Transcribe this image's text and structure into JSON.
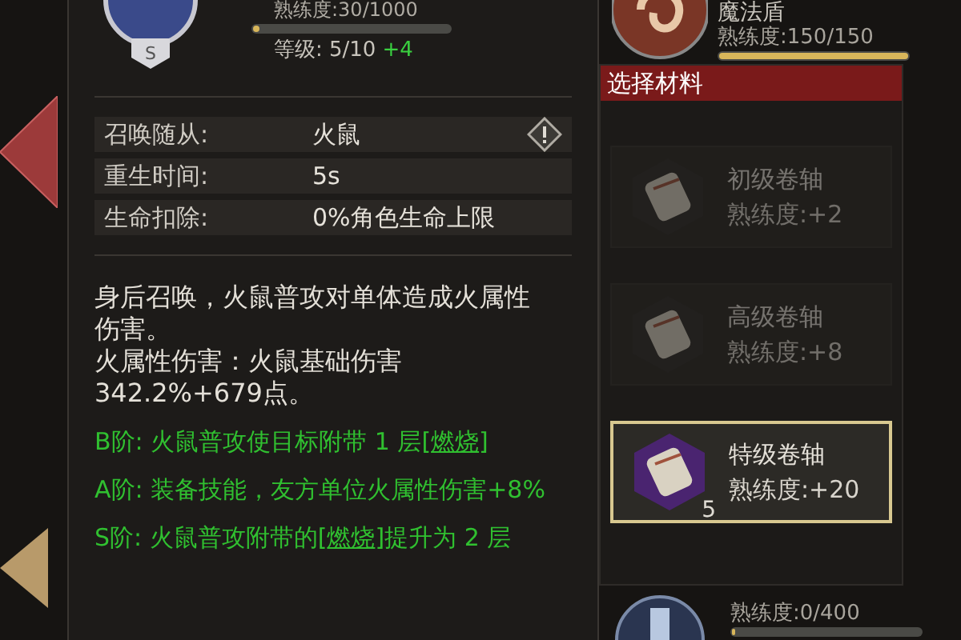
{
  "skill": {
    "grade": "S",
    "proficiency": "熟练度:30/1000",
    "level": 0.03,
    "rank": "等级: 5/10",
    "rank_bonus": "+4"
  },
  "attributes": [
    {
      "label": "召唤随从:",
      "value": "火鼠",
      "info": true
    },
    {
      "label": "重生时间:",
      "value": "5s",
      "info": false
    },
    {
      "label": "生命扣除:",
      "value": "0%角色生命上限",
      "info": false
    }
  ],
  "description": [
    "身后召唤，火鼠普攻对单体造成火属性伤害。",
    "火属性伤害：火鼠基础伤害342.2%+679点。"
  ],
  "upgrades": [
    [
      {
        "text": "B阶: 火鼠普攻使目标附带 1 层["
      },
      {
        "text": "燃烧",
        "kind": "link"
      },
      {
        "text": "]"
      }
    ],
    [
      {
        "text": "A阶: 装备技能，友方单位火属性伤害+8%"
      }
    ],
    [
      {
        "text": "S阶: 火鼠普攻附带的["
      },
      {
        "text": "燃烧",
        "kind": "link"
      },
      {
        "text": "]提升为 2 层"
      }
    ]
  ],
  "background_items": [
    {
      "name": "魔法盾",
      "proficiency": "熟练度:150/150",
      "level": 1
    },
    {
      "proficiency": "熟练度:0/400",
      "level": 0
    }
  ],
  "material_panel": {
    "title": "选择材料",
    "materials": [
      {
        "name": "初级卷轴",
        "proficiency": "熟练度:+2",
        "selected": false,
        "disabled": true
      },
      {
        "name": "高级卷轴",
        "proficiency": "熟练度:+8",
        "selected": false,
        "disabled": true
      },
      {
        "name": "特级卷轴",
        "proficiency": "熟练度:+20",
        "count": "5",
        "selected": true,
        "disabled": false
      }
    ]
  }
}
